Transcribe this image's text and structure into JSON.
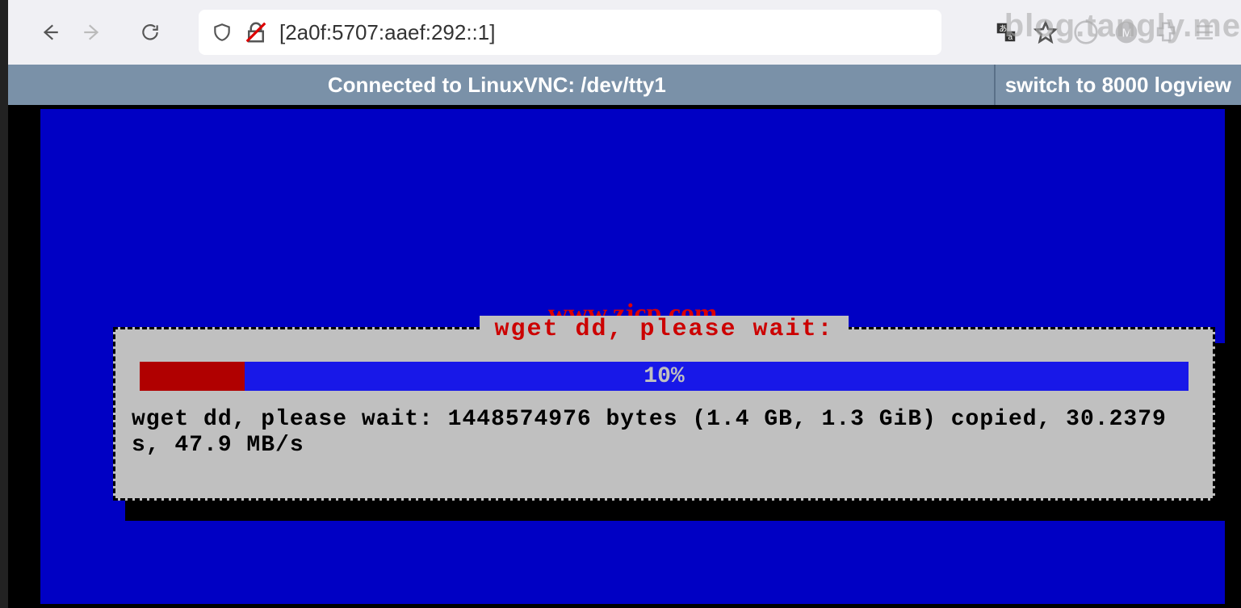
{
  "browser": {
    "url": "[2a0f:5707:aaef:292::1]"
  },
  "watermarks": {
    "blog": "blog.tangly.me",
    "site": "www.zjcp.com"
  },
  "vnc": {
    "title": "Connected to LinuxVNC: /dev/tty1",
    "switch_label": "switch to 8000 logview"
  },
  "dialog": {
    "title": "wget dd, please wait:",
    "progress_percent": 10,
    "progress_label": "10%",
    "progress_fill_width": "10%",
    "status": "wget dd, please wait: 1448574976 bytes (1.4 GB, 1.3 GiB) copied, 30.2379 s, 47.9 MB/s"
  }
}
